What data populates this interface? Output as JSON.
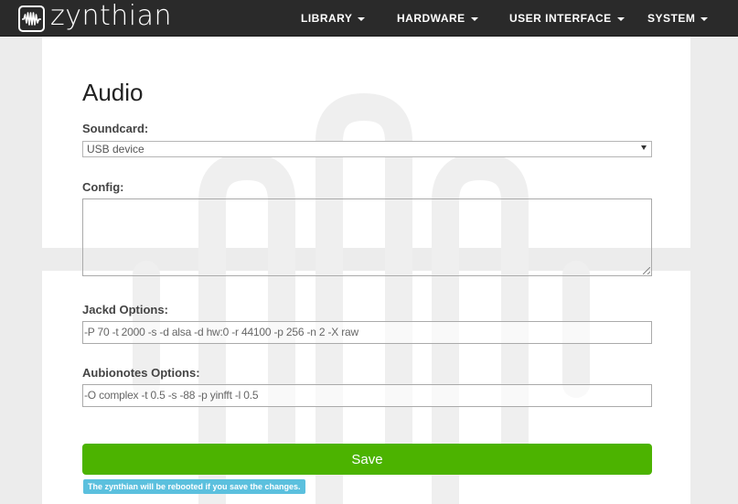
{
  "brand": {
    "name": "zynthian"
  },
  "nav": {
    "items": [
      {
        "label": "LIBRARY"
      },
      {
        "label": "HARDWARE"
      },
      {
        "label": "USER INTERFACE"
      },
      {
        "label": "SYSTEM"
      }
    ]
  },
  "page": {
    "title": "Audio"
  },
  "form": {
    "soundcard": {
      "label": "Soundcard:",
      "value": "USB device"
    },
    "config": {
      "label": "Config:",
      "value": ""
    },
    "jackd": {
      "label": "Jackd Options:",
      "value": "-P 70 -t 2000 -s -d alsa -d hw:0 -r 44100 -p 256 -n 2 -X raw"
    },
    "aubionotes": {
      "label": "Aubionotes Options:",
      "value": "-O complex -t 0.5 -s -88  -p yinfft -l 0.5"
    },
    "save_label": "Save",
    "note": "The zynthian will be rebooted if you save the changes."
  },
  "colors": {
    "navbar": "#2a2a2a",
    "save": "#4cb300",
    "note": "#5bc0de"
  }
}
